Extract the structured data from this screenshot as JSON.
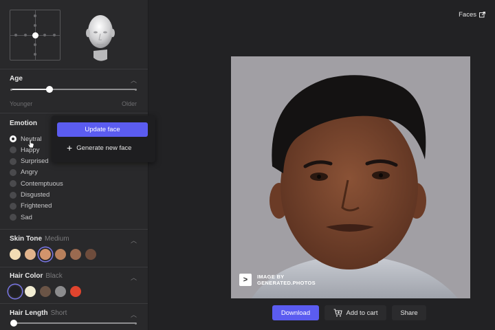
{
  "sidebar": {
    "age": {
      "title": "Age",
      "value": 0.31,
      "min_label": "Younger",
      "max_label": "Older"
    },
    "emotion": {
      "title": "Emotion",
      "options": [
        "Neutral",
        "Happy",
        "Surprised",
        "Angry",
        "Contemptuous",
        "Disgusted",
        "Frightened",
        "Sad"
      ],
      "selected": "Neutral"
    },
    "skin_tone": {
      "title": "Skin Tone",
      "value": "Medium",
      "colors": [
        "#f2dcb4",
        "#e2b48c",
        "#d2946c",
        "#b8805c",
        "#9a6a50",
        "#6e4c3c"
      ],
      "selected_index": 2
    },
    "hair_color": {
      "title": "Hair Color",
      "value": "Black",
      "colors": [
        "#1f1f22",
        "#f1ecd2",
        "#6a5446",
        "#8c8c8e",
        "#e0442e"
      ],
      "selected_index": 0
    },
    "hair_length": {
      "title": "Hair Length",
      "value": "Short",
      "slider_value": 0.02
    }
  },
  "popup": {
    "update_label": "Update face",
    "generate_label": "Generate new face"
  },
  "header": {
    "faces_link": "Faces"
  },
  "photo": {
    "watermark_line1": "IMAGE BY",
    "watermark_line2": "GENERATED.PHOTOS",
    "watermark_logo": ">"
  },
  "actions": {
    "download": "Download",
    "add_to_cart": "Add to cart",
    "share": "Share"
  },
  "colors": {
    "accent": "#5b5cf0",
    "background": "#222224",
    "sidebar": "#29292b"
  }
}
